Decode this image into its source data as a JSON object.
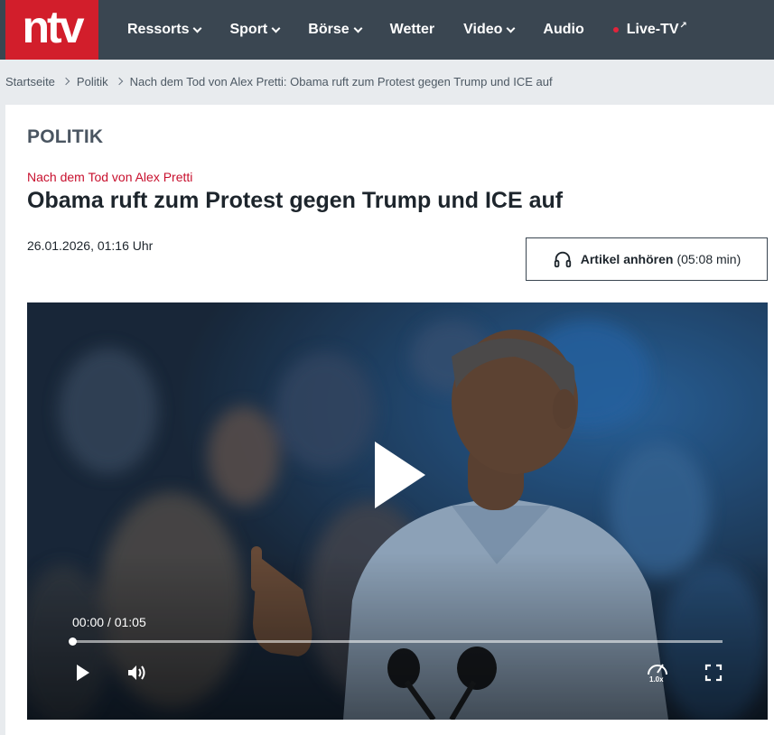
{
  "logo": {
    "text": "ntv",
    "brand_color": "#d21e2b"
  },
  "nav": {
    "items": [
      {
        "label": "Ressorts",
        "has_dropdown": true
      },
      {
        "label": "Sport",
        "has_dropdown": true
      },
      {
        "label": "Börse",
        "has_dropdown": true
      },
      {
        "label": "Wetter",
        "has_dropdown": false
      },
      {
        "label": "Video",
        "has_dropdown": true
      },
      {
        "label": "Audio",
        "has_dropdown": false
      }
    ],
    "live": {
      "label": "Live-TV",
      "indicator_color": "#e2243b"
    },
    "background": "#3a4651"
  },
  "breadcrumb": {
    "items": [
      "Startseite",
      "Politik",
      "Nach dem Tod von Alex Pretti: Obama ruft zum Protest gegen Trump und ICE auf"
    ]
  },
  "article": {
    "section": "POLITIK",
    "kicker": "Nach dem Tod von Alex Pretti",
    "headline": "Obama ruft zum Protest gegen Trump und ICE auf",
    "date": "26.01.2026, 01:16 Uhr",
    "listen": {
      "label": "Artikel anhören",
      "duration": "(05:08 min)",
      "icon": "headphones-icon"
    }
  },
  "video": {
    "timecode": "00:00 / 01:05",
    "progress": 0,
    "speed": "1.0x",
    "icons": [
      "play-icon",
      "volume-icon",
      "speed-icon",
      "fullscreen-icon"
    ]
  }
}
